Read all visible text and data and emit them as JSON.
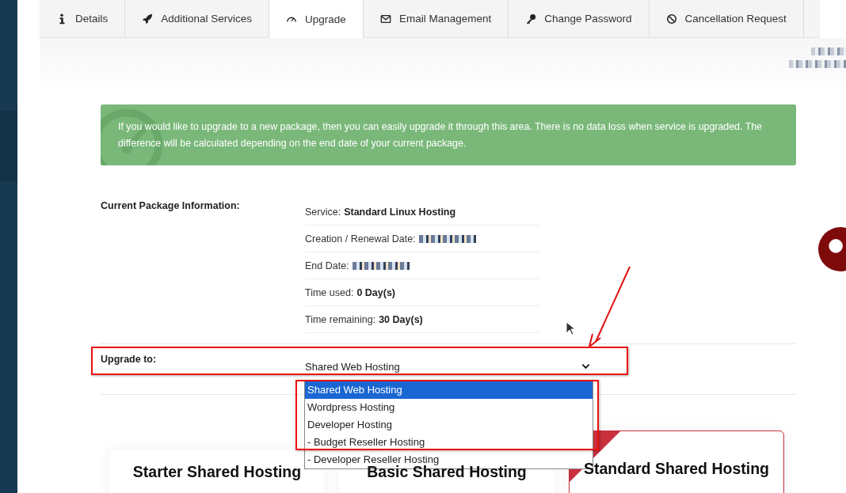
{
  "tabs": [
    {
      "label": "Details",
      "selected": false
    },
    {
      "label": "Additional Services",
      "selected": false
    },
    {
      "label": "Upgrade",
      "selected": true
    },
    {
      "label": "Email Management",
      "selected": false
    },
    {
      "label": "Change Password",
      "selected": false
    },
    {
      "label": "Cancellation Request",
      "selected": false
    }
  ],
  "notice": "If you would like to upgrade to a new package, then you can easily upgrade it through this area. There is no data loss when service is upgraded. The difference will be calculated depending on the end date of your current package.",
  "package": {
    "heading": "Current Package Information:",
    "rows": [
      {
        "label": "Service:",
        "value": "Standard Linux Hosting",
        "redacted": false
      },
      {
        "label": "Creation / Renewal Date:",
        "redacted": true
      },
      {
        "label": "End Date:",
        "redacted": true
      },
      {
        "label": "Time used:",
        "value": "0 Day(s)",
        "redacted": false
      },
      {
        "label": "Time remaining:",
        "value": "30 Day(s)",
        "redacted": false
      }
    ]
  },
  "upgrade": {
    "label": "Upgrade to:",
    "value": "Shared Web Hosting",
    "options": [
      {
        "label": "Shared Web Hosting",
        "selected": true
      },
      {
        "label": "Wordpress Hosting",
        "selected": false
      },
      {
        "label": "Developer Hosting",
        "selected": false
      },
      {
        "label": "- Budget Reseller Hosting",
        "selected": false
      },
      {
        "label": "- Developer Reseller Hosting",
        "selected": false
      }
    ]
  },
  "plans": [
    {
      "name": "Starter Shared Hosting",
      "featured": false
    },
    {
      "name": "Basic Shared Hosting",
      "featured": false
    },
    {
      "name": "Standard Shared Hosting",
      "featured": true
    }
  ]
}
